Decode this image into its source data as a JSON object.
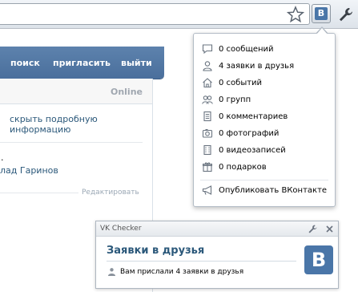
{
  "browser": {
    "extension_label": "B",
    "icons": [
      "star-icon",
      "vk-extension-icon",
      "wrench-icon"
    ]
  },
  "vk_page": {
    "nav": {
      "search": "поиск",
      "invite": "пригласить",
      "logout": "выйти"
    },
    "online_status": "Online",
    "hide_info_link": "скрыть подробную информацию",
    "dot": ".",
    "friend_name": "лад Гаринов",
    "edit_link": "Редактировать"
  },
  "popup": {
    "items": [
      {
        "label": "0 сообщений",
        "icon": "message-icon"
      },
      {
        "label": "4 заявки в друзья",
        "icon": "user-icon"
      },
      {
        "label": "0 событий",
        "icon": "home-icon"
      },
      {
        "label": "0 групп",
        "icon": "group-icon"
      },
      {
        "label": "0 комментариев",
        "icon": "comment-icon"
      },
      {
        "label": "0 фотографий",
        "icon": "camera-icon"
      },
      {
        "label": "0 видеозаписей",
        "icon": "film-icon"
      },
      {
        "label": "0 подарков",
        "icon": "gift-icon"
      }
    ],
    "publish": {
      "label": "Опубликовать ВКонтакте",
      "icon": "megaphone-icon"
    }
  },
  "notification": {
    "app_title": "VK Checker",
    "heading": "Заявки в друзья",
    "message": "Вам прислали 4 заявки в друзья",
    "logo_letter": "B"
  },
  "colors": {
    "vk_blue": "#4a76a8",
    "link_blue": "#2b587a",
    "header_blue": "#5d82ad"
  }
}
